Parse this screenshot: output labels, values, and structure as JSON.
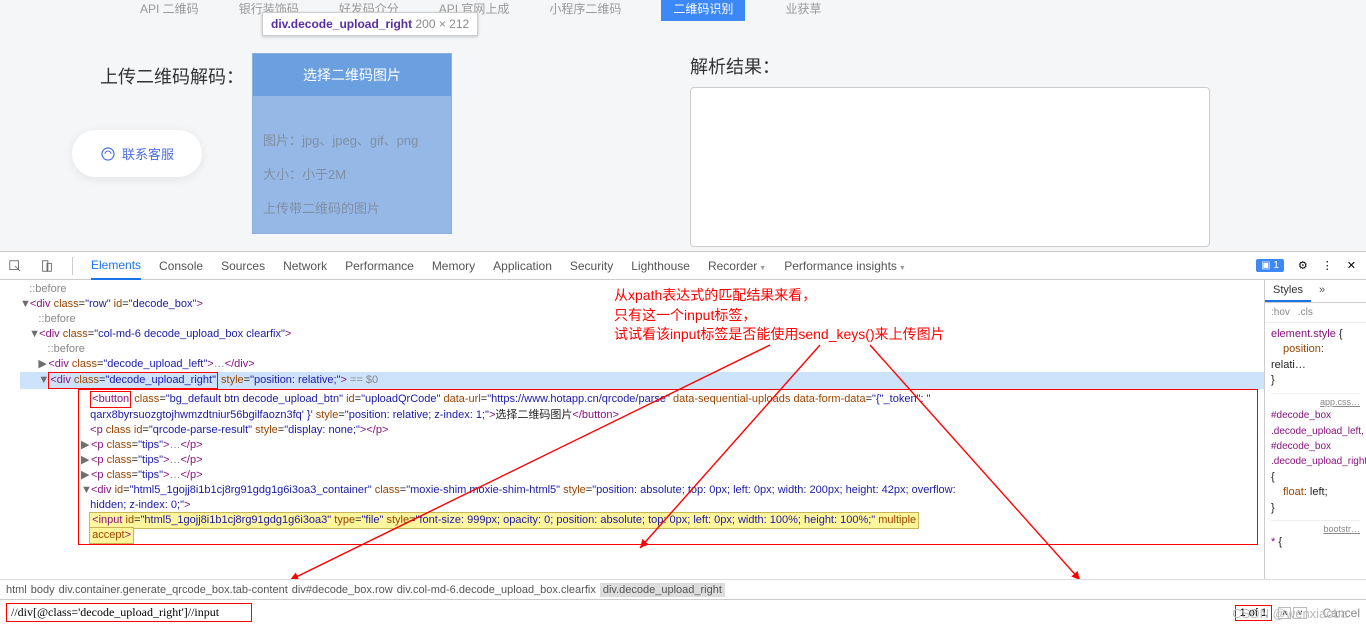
{
  "nav": {
    "tabs": [
      "API 二维码",
      "银行装饰码",
      "好发码介分",
      "API 官网上成",
      "小程序二维码",
      "二维码识别",
      "业获草"
    ],
    "activeIndex": 5
  },
  "tooltip": {
    "selector": "div.decode_upload_right",
    "dims": "200 × 212"
  },
  "upload": {
    "label": "上传二维码解码：",
    "button": "选择二维码图片",
    "tip1": "图片：jpg、jpeg、gif、png",
    "tip2": "大小：小于2M",
    "tip3": "上传带二维码的图片"
  },
  "contact": "联系客服",
  "result": {
    "label": "解析结果："
  },
  "devtools": {
    "tabs": [
      "Elements",
      "Console",
      "Sources",
      "Network",
      "Performance",
      "Memory",
      "Application",
      "Security",
      "Lighthouse",
      "Recorder",
      "Performance insights"
    ],
    "badge": "1",
    "breadcrumb": [
      "html",
      "body",
      "div.container.generate_qrcode_box.tab-content",
      "div#decode_box.row",
      "div.col-md-6.decode_upload_box.clearfix",
      "div.decode_upload_right"
    ],
    "searchValue": "//div[@class='decode_upload_right']//input",
    "searchCount": "1 of 1",
    "cancel": "Cancel"
  },
  "annotation": {
    "line1": "从xpath表达式的匹配结果来看，",
    "line2": "只有这一个input标签，",
    "line3": "试试看该input标签是否能使用send_keys()来上传图片"
  },
  "dom": {
    "before": "::before",
    "row_open": "<div class=\"row\" id=\"decode_box\">",
    "col_open": "<div class=\"col-md-6 decode_upload_box clearfix\">",
    "left": "<div class=\"decode_upload_left\">…</div>",
    "right_open_a": "<div class=\"",
    "right_open_cls": "decode_upload_right",
    "right_open_b": "\" style=\"position: relative;\">",
    "eq0": " == $0",
    "button_line1": "<button class=\"bg_default btn decode_upload_btn\" id=\"uploadQrCode\" data-url=\"https://www.hotapp.cn/qrcode/parse\" data-sequential-uploads data-form-data=\"{\"_token\": \"",
    "button_line2": "qarx8byrsuozgtojhwmzdtniur56bgilfaozn3fq' }' style=\"position: relative; z-index: 1;\">选择二维码图片</button>",
    "p_result": "<p class id=\"qrcode-parse-result\" style=\"display: none;\"></p>",
    "p_tips": "<p class=\"tips\">…</p>",
    "moxie": "<div id=\"html5_1gojj8i1b1cj8rg91gdg1g6i3oa3_container\" class=\"moxie-shim moxie-shim-html5\" style=\"position: absolute; top: 0px; left: 0px; width: 200px; height: 42px; overflow:",
    "moxie2": "hidden; z-index: 0;\">",
    "input_line": "<input id=\"html5_1gojj8i1b1cj8rg91gdg1g6i3oa3\" type=\"file\" style=\"font-size: 999px; opacity: 0; position: absolute; top: 0px; left: 0px; width: 100%; height: 100%;\" multiple",
    "input_line2": "accept>"
  },
  "styles": {
    "tab": "Styles",
    "hov": ":hov",
    "cls": ".cls",
    "rule1_sel": "element.style",
    "rule1_prop": "position",
    "rule1_val": "relati…",
    "rule2_file": "app.css…",
    "rule2_sel": "#decode_box .decode_upload_left, #decode_box .decode_upload_right",
    "rule2_prop": "float",
    "rule2_val": "left;",
    "rule3_file": "bootstr…",
    "rule3_sel": "*"
  },
  "watermark": "CSDN @wenxiaoba"
}
